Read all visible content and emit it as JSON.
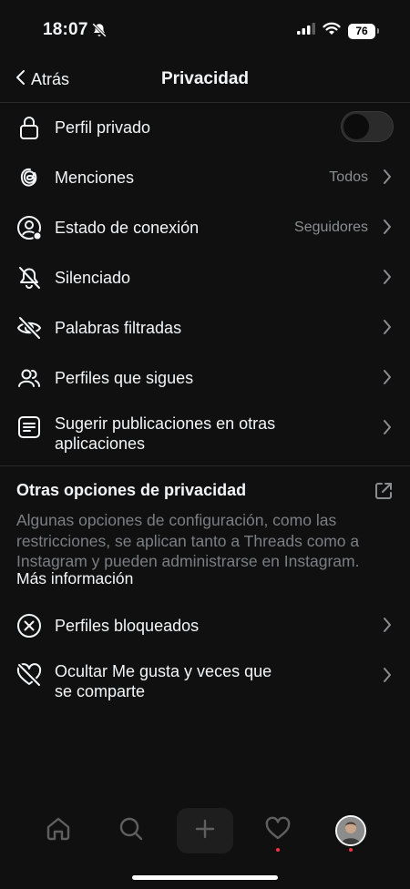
{
  "status": {
    "time": "18:07",
    "battery": "76"
  },
  "header": {
    "back_label": "Atrás",
    "title": "Privacidad"
  },
  "settings": [
    {
      "label": "Perfil privado",
      "icon": "lock-icon",
      "value": ""
    },
    {
      "label": "Menciones",
      "icon": "threads-icon",
      "value": "Todos"
    },
    {
      "label": "Estado de conexión",
      "icon": "online-status-icon",
      "value": "Seguidores"
    },
    {
      "label": "Silenciado",
      "icon": "muted-bell-icon",
      "value": ""
    },
    {
      "label": "Palabras filtradas",
      "icon": "hidden-eye-icon",
      "value": ""
    },
    {
      "label": "Perfiles que sigues",
      "icon": "people-icon",
      "value": ""
    },
    {
      "label": "Sugerir publicaciones en otras\naplicaciones",
      "icon": "document-icon",
      "value": ""
    }
  ],
  "other": {
    "title": "Otras opciones de privacidad",
    "description": "Algunas opciones de configuración, como las restricciones, se aplican tanto a Threads como a Instagram y pueden administrarse en Instagram.",
    "more_info": "Más información",
    "items": [
      {
        "label": "Perfiles bloqueados",
        "icon": "blocked-icon"
      },
      {
        "label": "Ocultar Me gusta y veces que\nse comparte",
        "icon": "hidden-heart-icon"
      }
    ]
  },
  "toggle": {
    "private_profile_on": false
  },
  "tabs": [
    "home",
    "search",
    "new-post",
    "activity",
    "profile"
  ],
  "colors": {
    "background": "#101010",
    "text": "#f3f5f7",
    "muted": "#8a8d91",
    "notification": "#ff3040"
  }
}
